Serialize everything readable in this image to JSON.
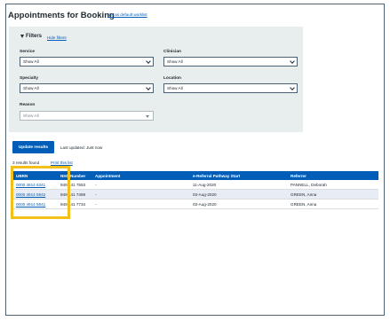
{
  "page": {
    "title": "Appointments for Booking",
    "default_worklist_link": "Set as default worklist"
  },
  "filters": {
    "toggle_label": "Filters",
    "hide_link": "Hide filters",
    "fields": [
      {
        "label": "Service",
        "value": "Show All",
        "disabled": false
      },
      {
        "label": "Clinician",
        "value": "Show All",
        "disabled": false
      },
      {
        "label": "Specialty",
        "value": "Show All",
        "disabled": false
      },
      {
        "label": "Location",
        "value": "Show All",
        "disabled": false
      },
      {
        "label": "Reason",
        "value": "Show All",
        "disabled": true
      }
    ]
  },
  "actions": {
    "update_button": "Update results",
    "last_updated": "Last updated: Just now",
    "results_found": "3 results found",
    "print_link": "Print this list"
  },
  "table": {
    "columns": [
      "UBRN",
      "NHS Number",
      "Appointment",
      "e-Referral Pathway Start",
      "Referrer"
    ],
    "rows": [
      [
        "0000 4914 6341",
        "949 441 7553",
        "-",
        "11-Aug-2020",
        "PANNELL, Deborah"
      ],
      [
        "0000 4914 5942",
        "949 441 7459",
        "-",
        "03-Aug-2020",
        "GREEN, Anna"
      ],
      [
        "0000 4914 5941",
        "949 441 7734",
        "-",
        "03-Aug-2020",
        "GREEN, Anna"
      ]
    ]
  },
  "colors": {
    "brand_blue": "#005eb8",
    "panel_grey": "#e8edee",
    "highlight": "#f5bf19",
    "row_stripe": "#e8ecf4"
  }
}
